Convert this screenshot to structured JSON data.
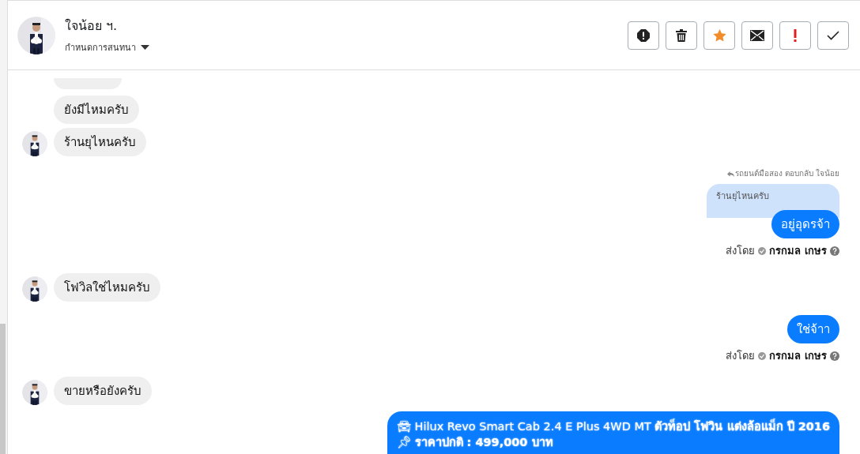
{
  "header": {
    "name": "ใจน้อย ฯ.",
    "subtitle": "กำหนดการสนทนา",
    "actions": [
      {
        "kind": "alert"
      },
      {
        "kind": "trash"
      },
      {
        "kind": "star"
      },
      {
        "kind": "mail"
      },
      {
        "kind": "important"
      },
      {
        "kind": "check"
      }
    ]
  },
  "messages": [
    {
      "kind": "cut_off"
    },
    {
      "kind": "incoming",
      "text": "ยังมีไหมครับ",
      "avatar": false
    },
    {
      "kind": "incoming",
      "text": "ร้านยุไหนครับ",
      "avatar": true
    },
    {
      "kind": "outgoing",
      "reply_meta": "รถยนต์มือสอง ตอบกลับ ใจน้อย",
      "quote": "ร้านยุไหนครับ",
      "text": "อยู่อุดรจ้า",
      "sent_by": "ส่งโดย",
      "sender": "กรกมล เกษร"
    },
    {
      "kind": "incoming",
      "text": "โฟวิลใช่ไหมครับ",
      "avatar": true
    },
    {
      "kind": "outgoing",
      "text": "ใช่จ้าา",
      "sent_by": "ส่งโดย",
      "sender": "กรกมล เกษร"
    },
    {
      "kind": "incoming",
      "text": "ขายหรือยังครับ",
      "avatar": true
    },
    {
      "kind": "listing",
      "lines": [
        "🚘 Hilux Revo Smart Cab 2.4 E Plus 4WD MT **ตัวท็อป โฟวิน แต่งล้อแม็ก ปี 2016**",
        "📌 **ราคาปกติ : 499,000 บาท**"
      ]
    }
  ]
}
